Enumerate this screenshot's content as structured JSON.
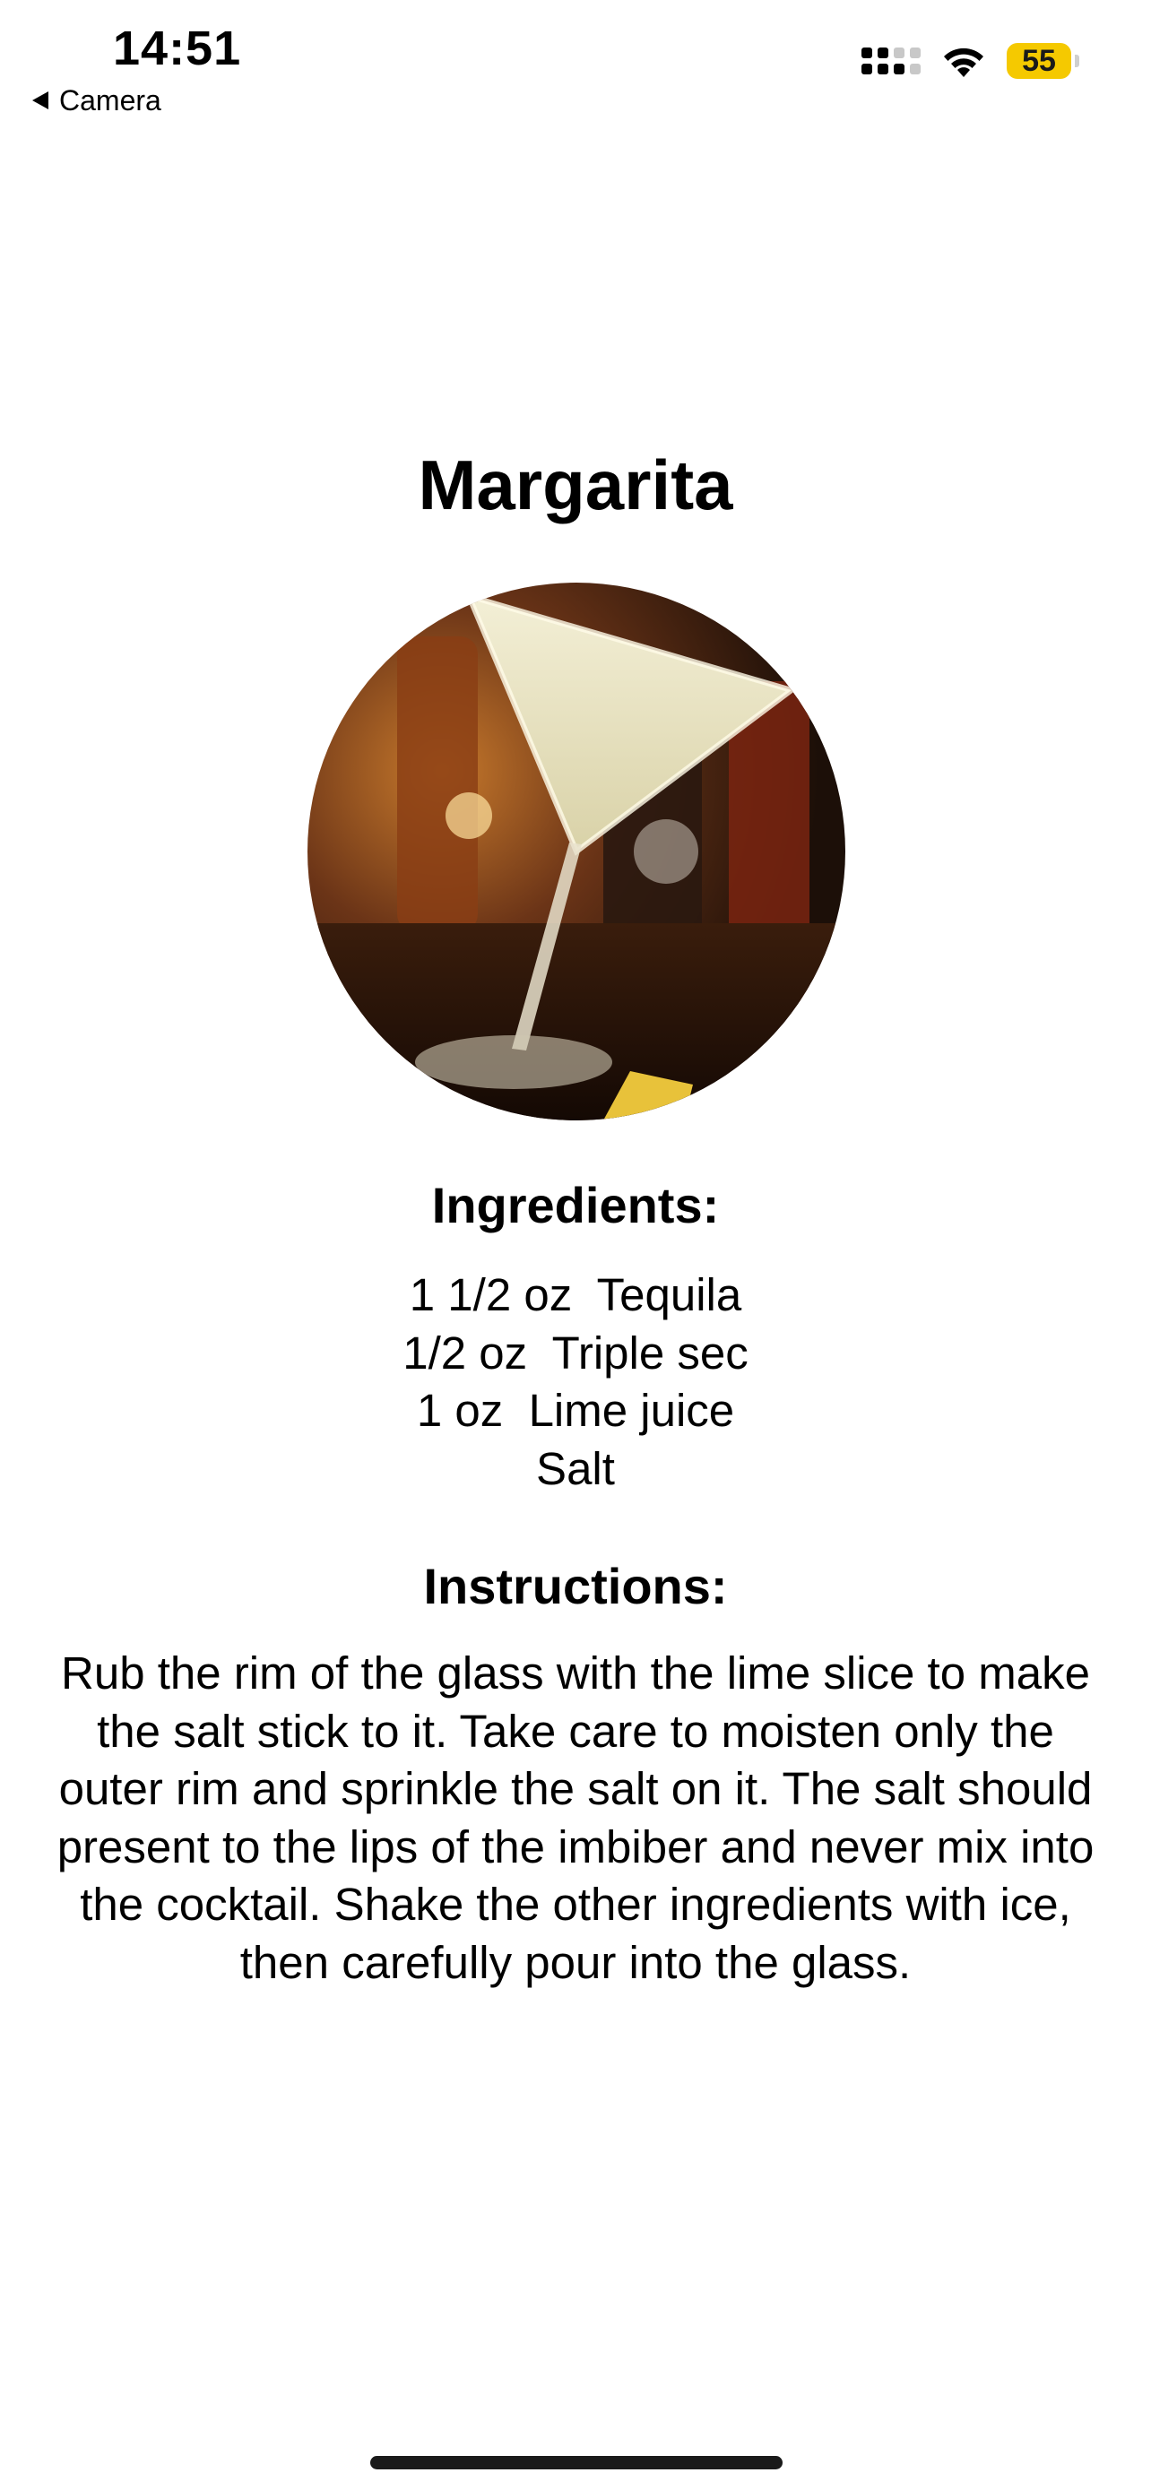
{
  "status_bar": {
    "time": "14:51",
    "back_label": "Camera",
    "battery_level": "55",
    "signal_icon": "cellular-signal-icon",
    "wifi_icon": "wifi-icon",
    "battery_color": "#f5c900"
  },
  "drink": {
    "name": "Margarita",
    "image_icon": "margarita-cocktail-photo"
  },
  "ingredients": {
    "heading": "Ingredients:",
    "items": [
      "1 1/2 oz  Tequila",
      "1/2 oz  Triple sec",
      "1 oz  Lime juice",
      "Salt"
    ]
  },
  "instructions": {
    "heading": "Instructions:",
    "text": "Rub the rim of the glass with the lime slice to make the salt stick to it. Take care to moisten only the outer rim and sprinkle the salt on it. The salt should present to the lips of the imbiber and never mix into the cocktail. Shake the other ingredients with ice, then carefully pour into the glass."
  }
}
